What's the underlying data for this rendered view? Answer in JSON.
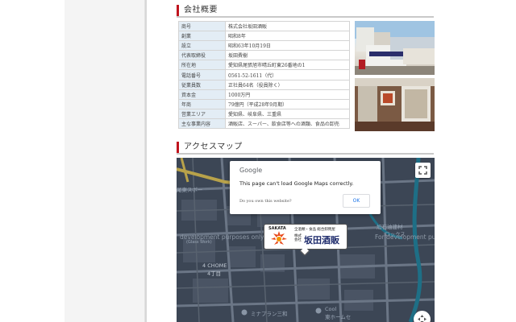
{
  "company_section": {
    "title": "会社概要",
    "rows": [
      {
        "key": "商号",
        "value": "株式会社坂田酒販"
      },
      {
        "key": "創業",
        "value": "昭和8年"
      },
      {
        "key": "設立",
        "value": "昭和63年10月19日"
      },
      {
        "key": "代表取締役",
        "value": "坂田費樹"
      },
      {
        "key": "所在地",
        "value": "愛知県尾張旭市晴丘町東26番地の1"
      },
      {
        "key": "電話番号",
        "value": "0561-52-1611（代）"
      },
      {
        "key": "従業員数",
        "value": "正社員64名（役員除く）"
      },
      {
        "key": "資本金",
        "value": "1000万円"
      },
      {
        "key": "年商",
        "value": "79億円（平成28年9月期）"
      },
      {
        "key": "営業エリア",
        "value": "愛知県、岐阜県、三重県"
      },
      {
        "key": "主な事業内容",
        "value": "酒販店、スーパー、飲食店等への酒類、食品の卸売"
      }
    ]
  },
  "access_section": {
    "title": "アクセスマップ"
  },
  "map": {
    "dialog_logo": "Google",
    "dialog_message": "This page can't load Google Maps correctly.",
    "dialog_link": "Do you own this website?",
    "dialog_ok": "OK",
    "marker": {
      "brand": "SAKATA",
      "kind": "全酒類・食品 総合卸問屋",
      "sub": "株式会社",
      "name": "坂田酒販"
    },
    "labels": {
      "dev_left": "development purposes only",
      "dev_right": "For development purp",
      "label_top_left": "尾東スポー",
      "label_right": "旭石油建材",
      "label_right2": "ロックス",
      "label_chome_en": "4 CHOME",
      "label_chome_ja": "4丁目",
      "label_water": "(Glass Work)",
      "label_poi1": "ミナプラン三和",
      "label_poi2": "Cool",
      "label_poi2b": "東ホームセ"
    },
    "colors": {
      "road": "#6b7686",
      "block": "#4a5464",
      "water": "#1e6f86",
      "bg": "#3c4655"
    }
  },
  "colors": {
    "accent": "#c0141e",
    "table_key_bg": "#e3edf5"
  }
}
